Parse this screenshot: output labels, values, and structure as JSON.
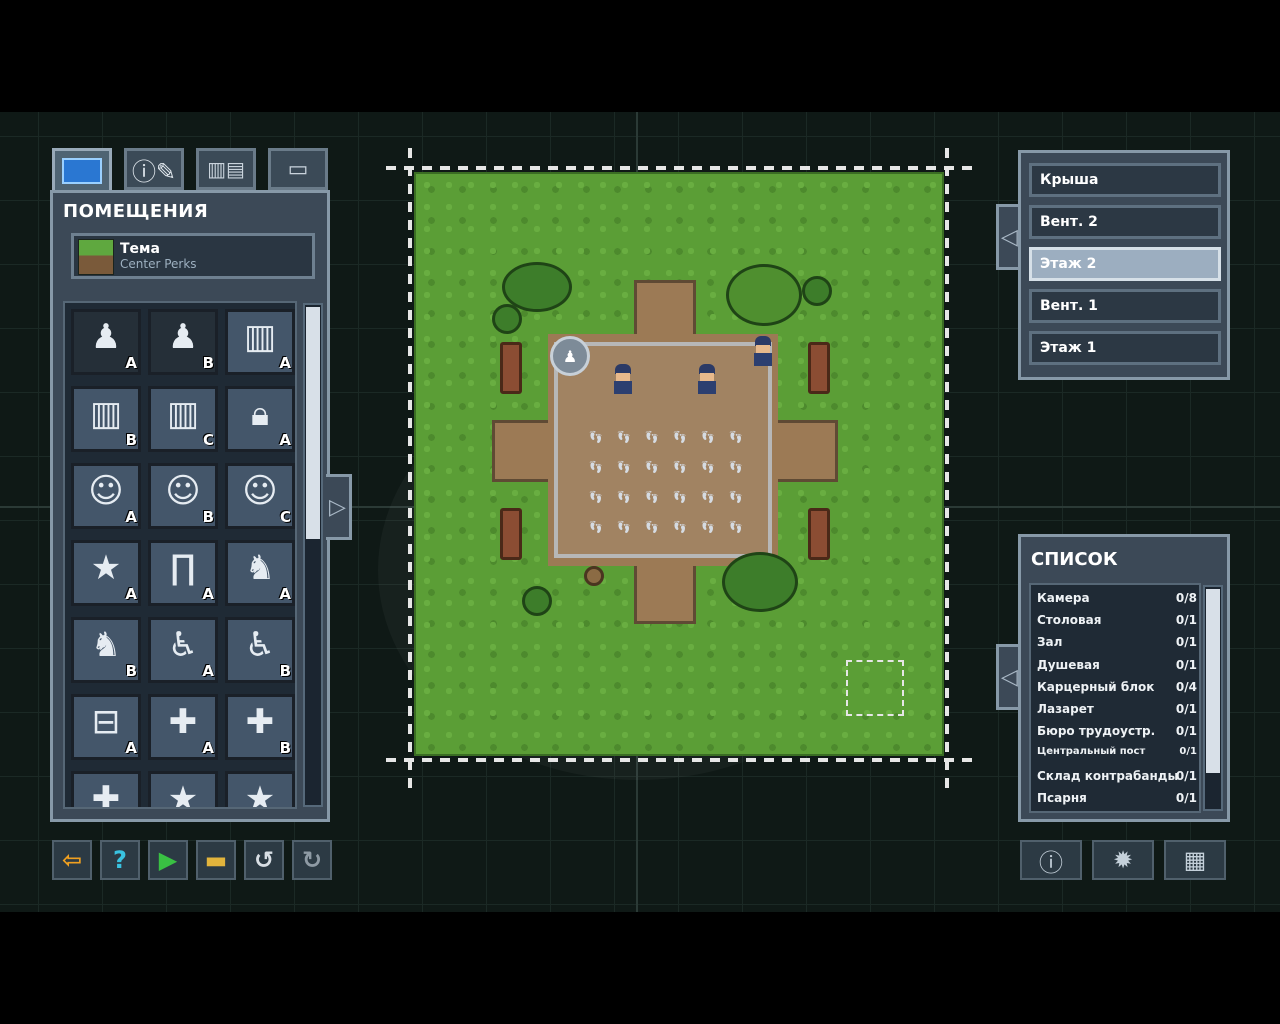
{
  "left_panel": {
    "title": "ПОМЕЩЕНИЯ",
    "tabs": [
      {
        "name": "rooms-tab",
        "icon": "blueprint-icon",
        "active": true
      },
      {
        "name": "info-tab",
        "icon": "info-pencil-icon",
        "active": false
      },
      {
        "name": "objects-tab",
        "icon": "furniture-icon",
        "active": false
      },
      {
        "name": "misc-tab",
        "icon": "bars-icon",
        "active": false
      }
    ],
    "theme": {
      "label": "Тема",
      "value": "Center Perks"
    },
    "rooms": [
      {
        "icon": "inmate-group-icon",
        "variant": "A",
        "dark": true
      },
      {
        "icon": "inmate-group-icon",
        "variant": "B",
        "dark": true
      },
      {
        "icon": "cell-bars-icon",
        "variant": "A",
        "dark": false
      },
      {
        "icon": "cell-bars-icon",
        "variant": "B",
        "dark": false
      },
      {
        "icon": "cell-bars-icon",
        "variant": "C",
        "dark": false
      },
      {
        "icon": "padlock-icon",
        "variant": "A",
        "dark": false
      },
      {
        "icon": "guard-head-icon",
        "variant": "A",
        "dark": false
      },
      {
        "icon": "guard-head-icon",
        "variant": "B",
        "dark": false
      },
      {
        "icon": "guard-head-icon",
        "variant": "C",
        "dark": false
      },
      {
        "icon": "star-icon",
        "variant": "A",
        "dark": false
      },
      {
        "icon": "metal-detector-icon",
        "variant": "A",
        "dark": false
      },
      {
        "icon": "dog-icon",
        "variant": "A",
        "dark": false
      },
      {
        "icon": "dog-icon",
        "variant": "B",
        "dark": false
      },
      {
        "icon": "wheelchair-icon",
        "variant": "A",
        "dark": false
      },
      {
        "icon": "wheelchair-icon",
        "variant": "B",
        "dark": false
      },
      {
        "icon": "toolbox-icon",
        "variant": "A",
        "dark": false
      },
      {
        "icon": "medkit-icon",
        "variant": "A",
        "dark": false
      },
      {
        "icon": "medkit-icon",
        "variant": "B",
        "dark": false
      },
      {
        "icon": "medkit-icon",
        "variant": "",
        "dark": false
      },
      {
        "icon": "star-icon",
        "variant": "",
        "dark": false
      },
      {
        "icon": "star-icon",
        "variant": "",
        "dark": false
      }
    ]
  },
  "bottom_left_tools": [
    {
      "name": "exit-button",
      "icon": "exit-icon",
      "glyph": "⇦",
      "color": "#f0a020"
    },
    {
      "name": "help-button",
      "icon": "question-icon",
      "glyph": "?",
      "color": "#39c2e0"
    },
    {
      "name": "play-button",
      "icon": "play-icon",
      "glyph": "▶",
      "color": "#39c043"
    },
    {
      "name": "open-button",
      "icon": "folder-icon",
      "glyph": "▬",
      "color": "#e2b43c"
    },
    {
      "name": "undo-button",
      "icon": "undo-icon",
      "glyph": "↺",
      "color": "#d8dee4"
    },
    {
      "name": "redo-button",
      "icon": "redo-icon",
      "glyph": "↻",
      "color": "#8e9aa4"
    }
  ],
  "floors": {
    "items": [
      "Крыша",
      "Вент. 2",
      "Этаж 2",
      "Вент. 1",
      "Этаж 1"
    ],
    "active": "Этаж 2"
  },
  "room_list": {
    "title": "СПИСОК",
    "rows": [
      {
        "name": "Камера",
        "count": "0/8"
      },
      {
        "name": "Столовая",
        "count": "0/1"
      },
      {
        "name": "Зал",
        "count": "0/1"
      },
      {
        "name": "Душевая",
        "count": "0/1"
      },
      {
        "name": "Карцерный блок",
        "count": "0/4"
      },
      {
        "name": "Лазарет",
        "count": "0/1"
      },
      {
        "name": "Бюро трудоустр.",
        "count": "0/1"
      },
      {
        "name": "Центральный пост",
        "count": "0/1"
      },
      {
        "name": "Склад контрабанды",
        "count": "0/1"
      },
      {
        "name": "Псарня",
        "count": "0/1"
      }
    ]
  },
  "bottom_right_tools": [
    {
      "name": "info-button",
      "icon": "info-icon",
      "glyph": "ⓘ"
    },
    {
      "name": "settings-button",
      "icon": "gear-icon",
      "glyph": "✹"
    },
    {
      "name": "grid-button",
      "icon": "grid-icon",
      "glyph": "▦"
    }
  ]
}
